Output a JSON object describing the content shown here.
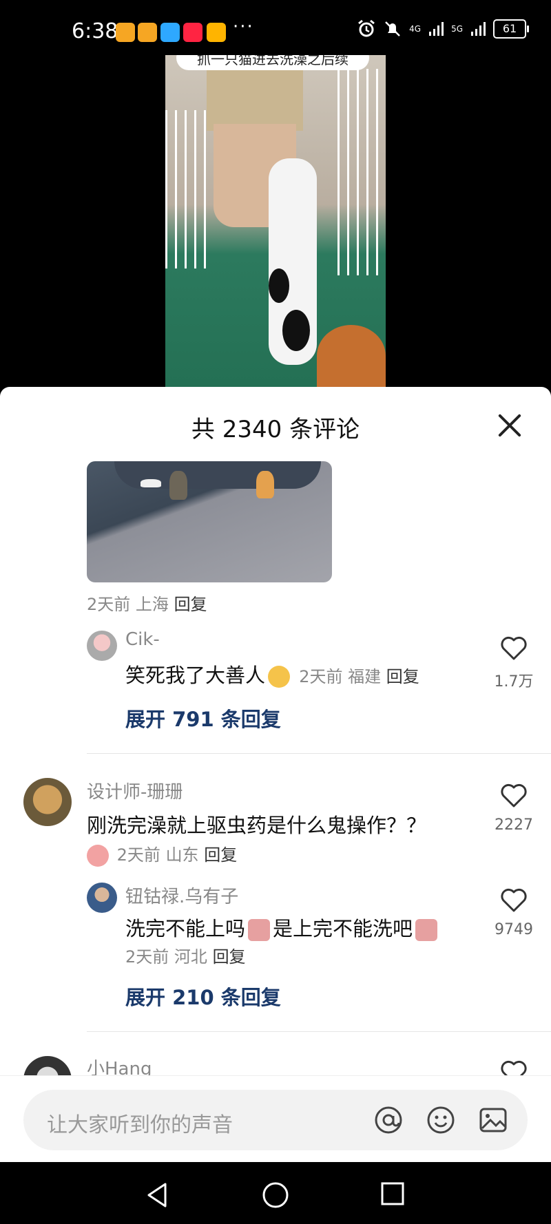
{
  "status_bar": {
    "time": "6:38",
    "dots": "···",
    "signal_4g": "4G",
    "signal_5g": "5G",
    "battery": "61"
  },
  "video": {
    "caption": "抓一只猫进去洗澡之后续"
  },
  "comments_sheet": {
    "title": "共 2340 条评论",
    "photo_comment_meta": {
      "time": "2天前",
      "location": "上海",
      "reply": "回复"
    },
    "threads": [
      {
        "user": "Cik-",
        "text": "笑死我了大善人",
        "time": "2天前",
        "location": "福建",
        "reply": "回复",
        "likes": "1.7万",
        "expand": "展开 791 条回复"
      },
      {
        "user": "设计师-珊珊",
        "text": "刚洗完澡就上驱虫药是什么鬼操作？？",
        "time": "2天前",
        "location": "山东",
        "reply": "回复",
        "likes": "2227",
        "sub_reply": {
          "user": "钮钴禄.乌有子",
          "text_a": "洗完不能上吗",
          "text_b": "是上完不能洗吧",
          "time": "2天前",
          "location": "河北",
          "reply": "回复",
          "likes": "9749"
        },
        "expand": "展开 210 条回复"
      },
      {
        "user": "小Hang"
      }
    ]
  },
  "input": {
    "placeholder": "让大家听到你的声音"
  },
  "colors": {
    "expand_link": "#1b3a6b",
    "meta_gray": "#888888",
    "sheet_bg": "#ffffff"
  }
}
